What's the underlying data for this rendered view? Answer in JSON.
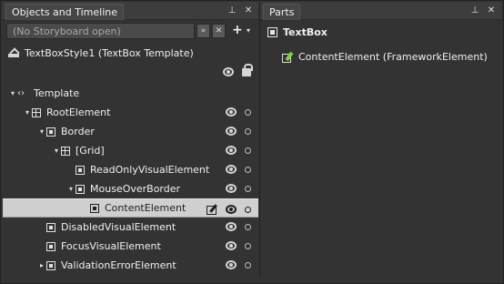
{
  "objects_panel": {
    "tab_title": "Objects and Timeline",
    "tab_icons": [
      "pin-icon",
      "close-icon"
    ],
    "storyboard_placeholder": "(No Storyboard open)",
    "template_header": "TextBoxStyle1 (TextBox Template)",
    "tree": [
      {
        "label": "Template",
        "depth": 0,
        "expander": "▾",
        "icon": "code-icon"
      },
      {
        "label": "RootElement",
        "depth": 1,
        "expander": "▾",
        "icon": "grid-icon"
      },
      {
        "label": "Border",
        "depth": 2,
        "expander": "▾",
        "icon": "element-icon"
      },
      {
        "label": "[Grid]",
        "depth": 3,
        "expander": "▾",
        "icon": "grid-icon"
      },
      {
        "label": "ReadOnlyVisualElement",
        "depth": 4,
        "expander": "",
        "icon": "element-icon"
      },
      {
        "label": "MouseOverBorder",
        "depth": 4,
        "expander": "▾",
        "icon": "element-icon"
      },
      {
        "label": "ContentElement",
        "depth": 5,
        "expander": "",
        "icon": "element-icon",
        "selected": true
      },
      {
        "label": "DisabledVisualElement",
        "depth": 2,
        "expander": "",
        "icon": "element-icon"
      },
      {
        "label": "FocusVisualElement",
        "depth": 2,
        "expander": "",
        "icon": "element-icon"
      },
      {
        "label": "ValidationErrorElement",
        "depth": 2,
        "expander": "▸",
        "icon": "element-icon"
      }
    ]
  },
  "parts_panel": {
    "tab_title": "Parts",
    "tab_icons": [
      "pin-icon",
      "close-icon"
    ],
    "type_title": "TextBox",
    "items": [
      {
        "label": "ContentElement (FrameworkElement)"
      }
    ]
  }
}
